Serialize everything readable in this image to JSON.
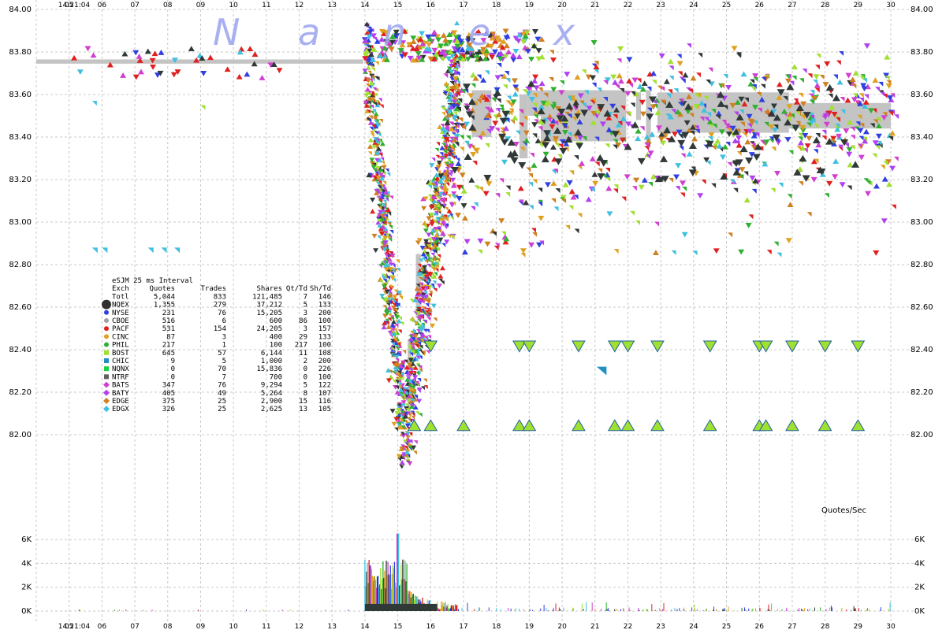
{
  "chart_data": {
    "type": "scatter",
    "ticker_label": "eSJM 25 ms Interval",
    "watermark": "Nanex",
    "x_ticks": [
      "14:21:04",
      "05",
      "06",
      "07",
      "08",
      "09",
      "10",
      "11",
      "12",
      "13",
      "14",
      "15",
      "16",
      "17",
      "18",
      "19",
      "20",
      "21",
      "22",
      "23",
      "24",
      "25",
      "26",
      "27",
      "28",
      "29",
      "30"
    ],
    "x_range_seconds": [
      4,
      30
    ],
    "price_ylim": [
      81.6,
      84.0
    ],
    "price_ticks": [
      "84.00",
      "83.80",
      "83.60",
      "83.40",
      "83.20",
      "83.00",
      "82.80",
      "82.60",
      "82.40",
      "82.20",
      "82.00"
    ],
    "volume_label": "Quotes/Sec",
    "volume_ylim": [
      0,
      7000
    ],
    "volume_ticks": [
      "6K",
      "4K",
      "2K",
      "0K"
    ],
    "grid": true,
    "summary_header": [
      "Exch",
      "Quotes",
      "Trades",
      "Shares",
      "Qt/Td",
      "Sh/Td"
    ],
    "summary_rows": [
      {
        "exch": "Totl",
        "quotes": "5,044",
        "trades": "833",
        "shares": "121,485",
        "qt_td": "7",
        "sh_td": "146",
        "color": "#000000",
        "marker": "none"
      },
      {
        "exch": "NQEX",
        "quotes": "1,355",
        "trades": "279",
        "shares": "37,212",
        "qt_td": "5",
        "sh_td": "133",
        "color": "#303030",
        "marker": "big-circle"
      },
      {
        "exch": "NYSE",
        "quotes": "231",
        "trades": "76",
        "shares": "15,205",
        "qt_td": "3",
        "sh_td": "200",
        "color": "#3040e0",
        "marker": "circle"
      },
      {
        "exch": "CBOE",
        "quotes": "516",
        "trades": "6",
        "shares": "600",
        "qt_td": "86",
        "sh_td": "100",
        "color": "#a0a0a0",
        "marker": "circle"
      },
      {
        "exch": "PACF",
        "quotes": "531",
        "trades": "154",
        "shares": "24,205",
        "qt_td": "3",
        "sh_td": "157",
        "color": "#e02020",
        "marker": "circle"
      },
      {
        "exch": "CINC",
        "quotes": "87",
        "trades": "3",
        "shares": "400",
        "qt_td": "29",
        "sh_td": "133",
        "color": "#e0a020",
        "marker": "circle"
      },
      {
        "exch": "PHIL",
        "quotes": "217",
        "trades": "1",
        "shares": "100",
        "qt_td": "217",
        "sh_td": "100",
        "color": "#30b030",
        "marker": "circle"
      },
      {
        "exch": "BOST",
        "quotes": "645",
        "trades": "57",
        "shares": "6,144",
        "qt_td": "11",
        "sh_td": "108",
        "color": "#a0e030",
        "marker": "square"
      },
      {
        "exch": "CHIC",
        "quotes": "9",
        "trades": "5",
        "shares": "1,000",
        "qt_td": "2",
        "sh_td": "200",
        "color": "#2090c0",
        "marker": "square"
      },
      {
        "exch": "NQNX",
        "quotes": "0",
        "trades": "70",
        "shares": "15,836",
        "qt_td": "0",
        "sh_td": "226",
        "color": "#20d040",
        "marker": "square"
      },
      {
        "exch": "NTRF",
        "quotes": "0",
        "trades": "7",
        "shares": "700",
        "qt_td": "0",
        "sh_td": "100",
        "color": "#606060",
        "marker": "square"
      },
      {
        "exch": "BATS",
        "quotes": "347",
        "trades": "76",
        "shares": "9,294",
        "qt_td": "5",
        "sh_td": "122",
        "color": "#d040d0",
        "marker": "diamond"
      },
      {
        "exch": "BATY",
        "quotes": "405",
        "trades": "49",
        "shares": "5,264",
        "qt_td": "8",
        "sh_td": "107",
        "color": "#b040f0",
        "marker": "diamond"
      },
      {
        "exch": "EDGE",
        "quotes": "375",
        "trades": "25",
        "shares": "2,900",
        "qt_td": "15",
        "sh_td": "116",
        "color": "#d08020",
        "marker": "diamond"
      },
      {
        "exch": "EDGX",
        "quotes": "326",
        "trades": "25",
        "shares": "2,625",
        "qt_td": "13",
        "sh_td": "105",
        "color": "#40c0e0",
        "marker": "diamond"
      }
    ],
    "nbbo_band": [
      {
        "x0": 4.0,
        "x1": 13.95,
        "lo": 83.745,
        "hi": 83.765
      },
      {
        "x0": 17.25,
        "x1": 17.85,
        "lo": 83.4,
        "hi": 83.62
      },
      {
        "x0": 18.7,
        "x1": 18.95,
        "lo": 83.3,
        "hi": 83.6
      },
      {
        "x0": 18.95,
        "x1": 21.95,
        "lo": 83.5,
        "hi": 83.62
      },
      {
        "x0": 19.35,
        "x1": 21.95,
        "lo": 83.38,
        "hi": 83.5
      },
      {
        "x0": 22.25,
        "x1": 22.4,
        "lo": 83.48,
        "hi": 83.61
      },
      {
        "x0": 22.55,
        "x1": 22.7,
        "lo": 83.38,
        "hi": 83.62
      },
      {
        "x0": 22.9,
        "x1": 26.9,
        "lo": 83.42,
        "hi": 83.61
      },
      {
        "x0": 26.9,
        "x1": 30.0,
        "lo": 83.44,
        "hi": 83.56
      },
      {
        "x0": 15.55,
        "x1": 15.7,
        "lo": 82.55,
        "hi": 82.85
      },
      {
        "x0": 15.3,
        "x1": 15.4,
        "lo": 82.1,
        "hi": 82.45
      }
    ],
    "green_markers_upper": [
      16.0,
      18.7,
      19.0,
      20.5,
      21.6,
      22.0,
      22.9,
      24.5,
      26.0,
      26.2,
      27.0,
      28.0,
      29.0
    ],
    "green_markers_upper_price": 82.42,
    "green_markers_lower": [
      15.5,
      16.0,
      17.0,
      18.7,
      19.0,
      20.5,
      21.6,
      22.0,
      22.9,
      24.5,
      26.0,
      26.2,
      27.0,
      28.0,
      29.0
    ],
    "green_markers_lower_price": 82.04,
    "volume_peak": 6500
  }
}
